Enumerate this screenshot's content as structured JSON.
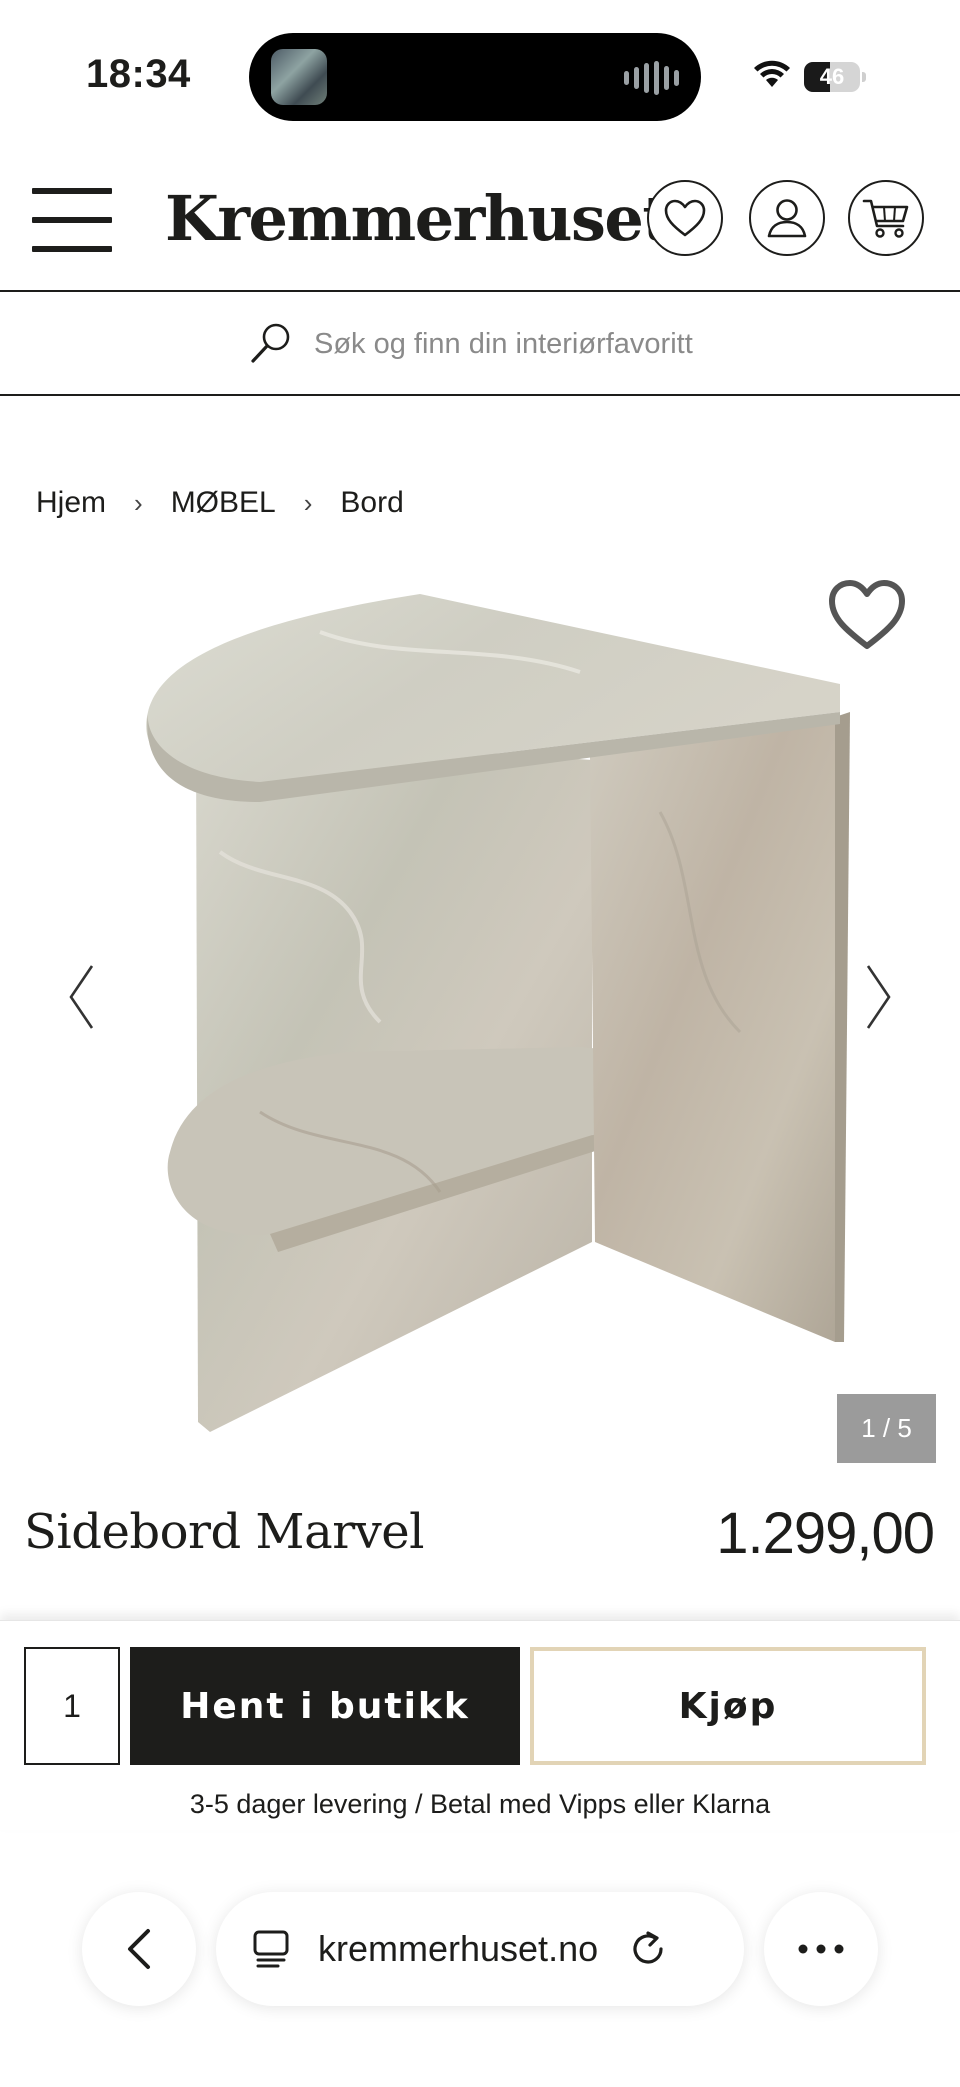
{
  "status_bar": {
    "time": "18:34",
    "battery_level": "46",
    "battery_fraction": 0.46
  },
  "header": {
    "brand": "Kremmerhuset",
    "icons": [
      "menu-icon",
      "heart-icon",
      "user-icon",
      "cart-icon"
    ]
  },
  "search": {
    "placeholder": "Søk og finn din interiørfavoritt"
  },
  "breadcrumb": {
    "items": [
      "Hjem",
      "MØBEL",
      "Bord"
    ],
    "separator": "›"
  },
  "gallery": {
    "counter": "1 / 5",
    "current": 1,
    "total": 5
  },
  "product": {
    "title": "Sidebord Marvel",
    "price": "1.299,00"
  },
  "purchase": {
    "quantity": "1",
    "pickup_label": "Hent i butikk",
    "buy_label": "Kjøp",
    "delivery_note": "3-5 dager levering / Betal med Vipps eller Klarna"
  },
  "browser": {
    "url": "kremmerhuset.no"
  },
  "colors": {
    "text": "#1d1d1b",
    "accent_border": "#e2d4b6",
    "counter_bg": "#9b9b9b"
  }
}
